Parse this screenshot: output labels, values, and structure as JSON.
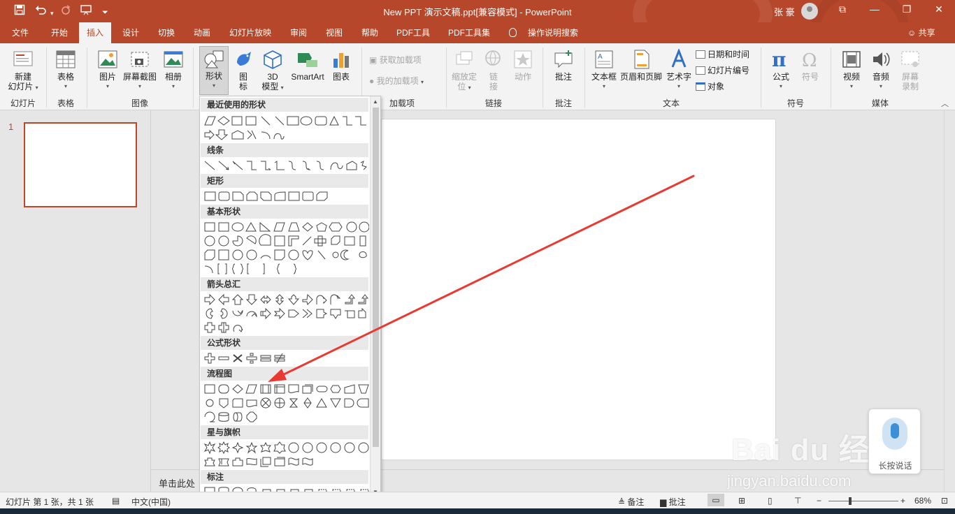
{
  "titlebar": {
    "title": "New PPT 演示文稿.ppt[兼容模式]  -  PowerPoint",
    "user": "张 豪",
    "btn_ribbon_opts": "⧉",
    "btn_minimize": "—",
    "btn_restore": "❐",
    "btn_close": "✕"
  },
  "tabs": [
    {
      "label": "文件"
    },
    {
      "label": "开始"
    },
    {
      "label": "插入"
    },
    {
      "label": "设计"
    },
    {
      "label": "切换"
    },
    {
      "label": "动画"
    },
    {
      "label": "幻灯片放映"
    },
    {
      "label": "审阅"
    },
    {
      "label": "视图"
    },
    {
      "label": "帮助"
    },
    {
      "label": "PDF工具"
    },
    {
      "label": "PDF工具集"
    },
    {
      "label": "操作说明搜索"
    }
  ],
  "share_label": "共享",
  "ribbon": {
    "new_slide_1": "新建",
    "new_slide_2": "幻灯片",
    "group_slides": "幻灯片",
    "table": "表格",
    "group_tables": "表格",
    "picture": "图片",
    "screenshot": "屏幕截图",
    "album": "相册",
    "group_images": "图像",
    "shapes": "形状",
    "icons_1": "图",
    "icons_2": "标",
    "model3d_1": "3D",
    "model3d_2": "模型",
    "smartart": "SmartArt",
    "chart": "图表",
    "get_addins": "获取加载项",
    "my_addins": "我的加载项",
    "group_addins": "加载项",
    "zoom_1": "缩放定",
    "zoom_2": "位",
    "link_1": "链",
    "link_2": "接",
    "action": "动作",
    "group_links": "链接",
    "comment": "批注",
    "group_comments": "批注",
    "textbox": "文本框",
    "header_footer": "页眉和页脚",
    "wordart": "艺术字",
    "datetime": "日期和时间",
    "slide_number": "幻灯片编号",
    "object": "对象",
    "group_text": "文本",
    "equation": "公式",
    "symbol": "符号",
    "group_symbols": "符号",
    "video": "视频",
    "audio": "音频",
    "screenrec_1": "屏幕",
    "screenrec_2": "录制",
    "group_media": "媒体"
  },
  "thumbs": {
    "slide_number": "1"
  },
  "shapes_gallery": {
    "sections": [
      {
        "title": "最近使用的形状"
      },
      {
        "title": "线条"
      },
      {
        "title": "矩形"
      },
      {
        "title": "基本形状"
      },
      {
        "title": "箭头总汇"
      },
      {
        "title": "公式形状"
      },
      {
        "title": "流程图"
      },
      {
        "title": "星与旗帜"
      },
      {
        "title": "标注"
      }
    ]
  },
  "notes_placeholder": "单击此处",
  "status": {
    "slide_info": "幻灯片 第 1 张，共 1 张",
    "language": "中文(中国)",
    "notes": "备注",
    "comments": "批注",
    "zoom_minus": "−",
    "zoom_plus": "+",
    "zoom": "68%"
  },
  "voice_widget": {
    "label": "长按说话"
  },
  "watermark": {
    "logo": "Bai du 经验",
    "url": "jingyan.baidu.com"
  },
  "colors": {
    "brand": "#b7472a",
    "arrow": "#e83a33"
  }
}
